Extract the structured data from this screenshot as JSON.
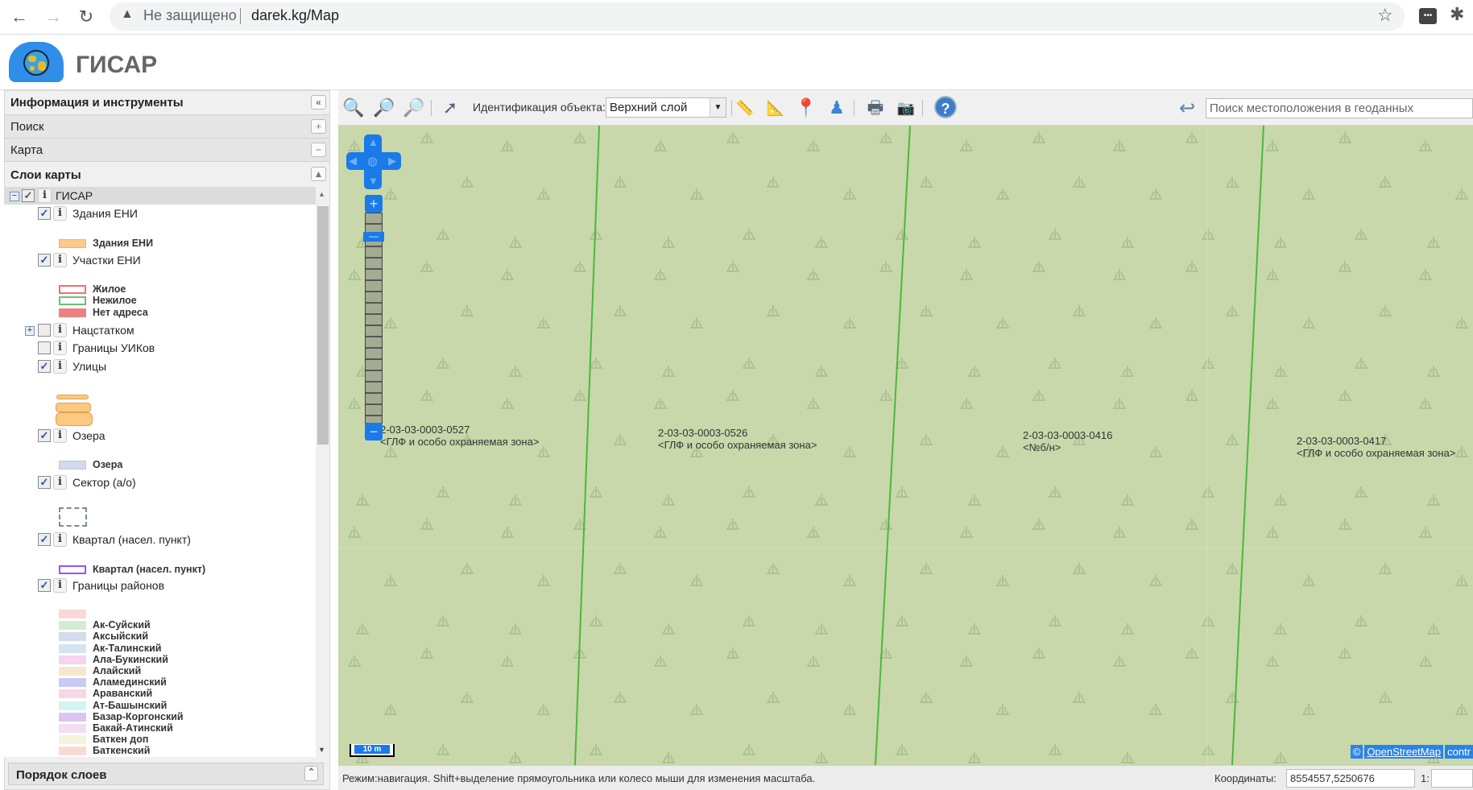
{
  "browser": {
    "security": "Не защищено",
    "url": "darek.kg/Map"
  },
  "app": {
    "title": "ГИСАР"
  },
  "panel": {
    "title": "Информация и инструменты",
    "search": "Поиск",
    "map": "Карта",
    "layers": "Слои карты",
    "order": "Порядок слоев"
  },
  "tree": {
    "root": "ГИСАР",
    "buildings": "Здания ЕНИ",
    "buildings_legend": "Здания ЕНИ",
    "parcels": "Участки ЕНИ",
    "parcels_legend": [
      "Жилое",
      "Нежилое",
      "Нет адреса"
    ],
    "natstat": "Нацстатком",
    "uik": "Границы УИКов",
    "streets": "Улицы",
    "lakes": "Озера",
    "lakes_legend": "Озера",
    "sector": "Сектор (а/о)",
    "block": "Квартал (насел. пункт)",
    "block_legend": "Квартал (насел. пункт)",
    "districts": "Границы районов",
    "districts_legend": [
      "",
      "Ак-Суйский",
      "Аксыйский",
      "Ак-Талинский",
      "Ала-Букинский",
      "Алайский",
      "Аламединский",
      "Араванский",
      "Ат-Башынский",
      "Базар-Коргонский",
      "Бакай-Атинский",
      "Баткен доп",
      "Баткенский"
    ],
    "districts_colors": [
      "#f8d8d8",
      "#d4ecd4",
      "#d4dcee",
      "#d4e4f0",
      "#f4d4ee",
      "#f6e8cc",
      "#c8ccf4",
      "#f4d8e4",
      "#d4f4f0",
      "#dcc4f0",
      "#f4dcf4",
      "#f4f4dc",
      "#f8dcd4"
    ]
  },
  "toolbar": {
    "identify_label": "Идентификация объекта:",
    "identify_value": "Верхний слой",
    "search_placeholder": "Поиск местоположения в геоданных"
  },
  "map": {
    "parcels": [
      {
        "id": "2-03-03-0003-0527",
        "type": "<ГЛФ и особо охраняемая зона>"
      },
      {
        "id": "2-03-03-0003-0526",
        "type": "<ГЛФ и особо охраняемая зона>"
      },
      {
        "id": "2-03-03-0003-0416",
        "type": "<№б/н>"
      },
      {
        "id": "2-03-03-0003-0417",
        "type": "<ГЛФ и особо охраняемая зона>"
      }
    ],
    "scale": "10 m",
    "attribution": [
      "©",
      "OpenStreetMap",
      "contr"
    ]
  },
  "status": {
    "mode": "Режим:навигация. Shift+выделение прямоугольника или колесо мыши для изменения масштаба.",
    "coords_label": "Координаты:",
    "coords_value": "8554557,5250676",
    "scale_label": "1:"
  }
}
